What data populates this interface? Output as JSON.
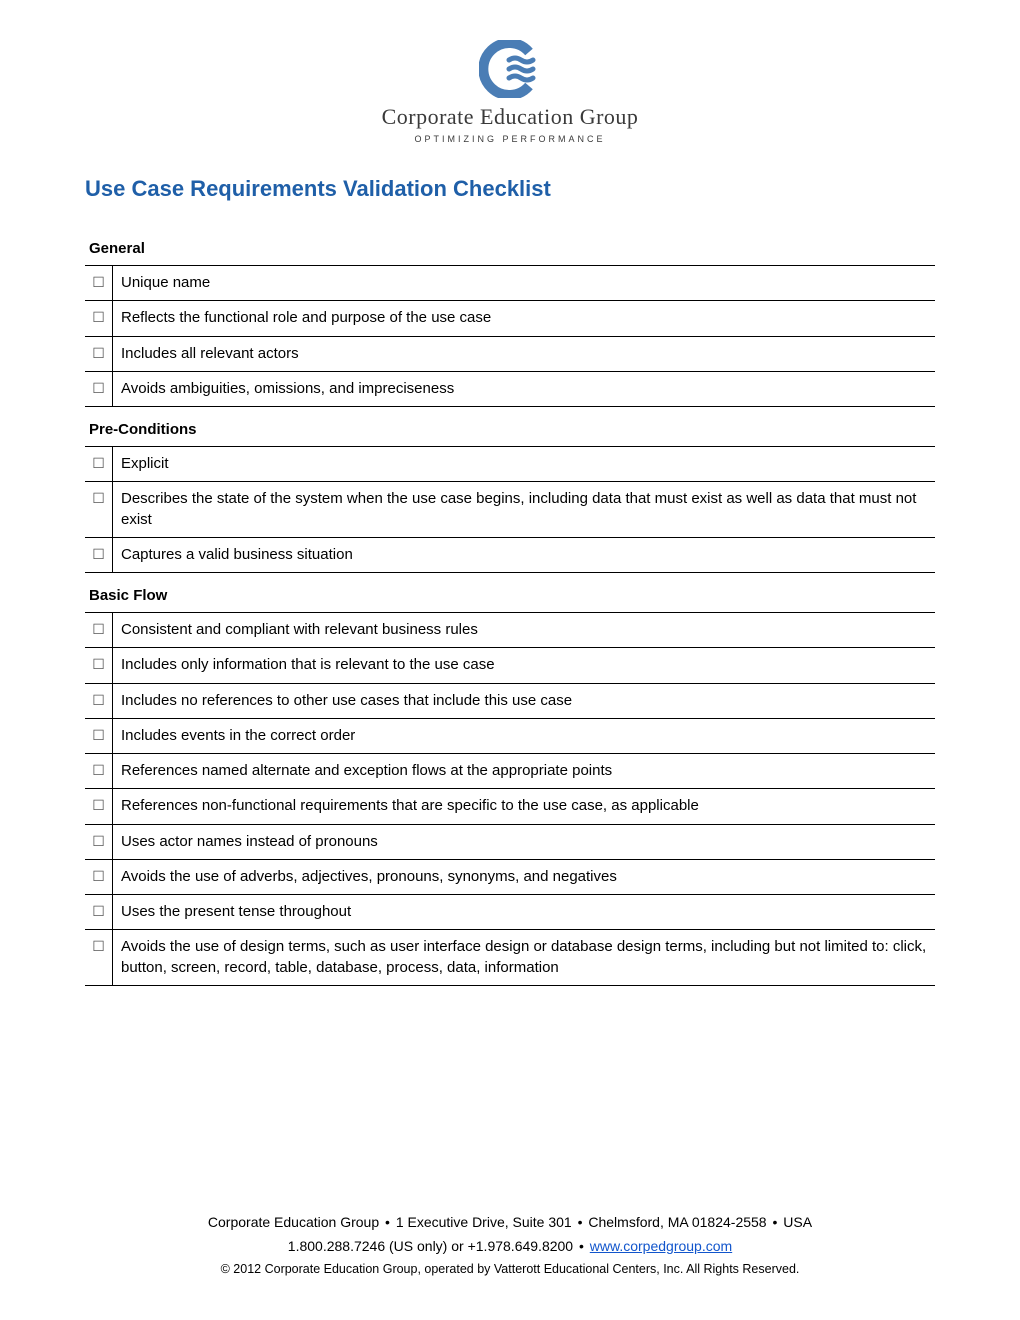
{
  "header": {
    "company_name": "Corporate Education Group",
    "tagline": "OPTIMIZING PERFORMANCE"
  },
  "title": "Use Case Requirements Validation Checklist",
  "sections": [
    {
      "heading": "General",
      "items": [
        "Unique name",
        "Reflects the functional role and purpose of the use case",
        "Includes all relevant actors",
        "Avoids ambiguities, omissions, and impreciseness"
      ]
    },
    {
      "heading": "Pre-Conditions",
      "items": [
        "Explicit",
        "Describes the state of the system when the use case begins, including data that must exist as well as data that must not exist",
        "Captures a valid business situation"
      ]
    },
    {
      "heading": "Basic Flow",
      "items": [
        "Consistent and compliant with relevant business rules",
        "Includes only information that is relevant to the use case",
        "Includes no references to other use cases that include this use case",
        "Includes events in the correct order",
        "References named alternate and exception flows at the appropriate points",
        "References non-functional requirements that are specific to the use case, as applicable",
        "Uses actor names instead of pronouns",
        "Avoids the use of adverbs, adjectives, pronouns, synonyms, and negatives",
        "Uses the present tense throughout",
        "Avoids the use of design terms, such as user interface design or database design terms, including but not limited to: click, button, screen, record, table, database, process, data, information"
      ]
    }
  ],
  "footer": {
    "line1_company": "Corporate Education Group",
    "line1_address": "1 Executive Drive, Suite 301",
    "line1_city": "Chelmsford, MA 01824-2558",
    "line1_country": "USA",
    "line2_phone_us": "1.800.288.7246 (US only)",
    "line2_or": " or ",
    "line2_phone_intl": "+1.978.649.8200",
    "line2_link": "www.corpedgroup.com",
    "copyright": "© 2012 Corporate Education Group, operated by Vatterott Educational Centers, Inc. All Rights Reserved."
  }
}
